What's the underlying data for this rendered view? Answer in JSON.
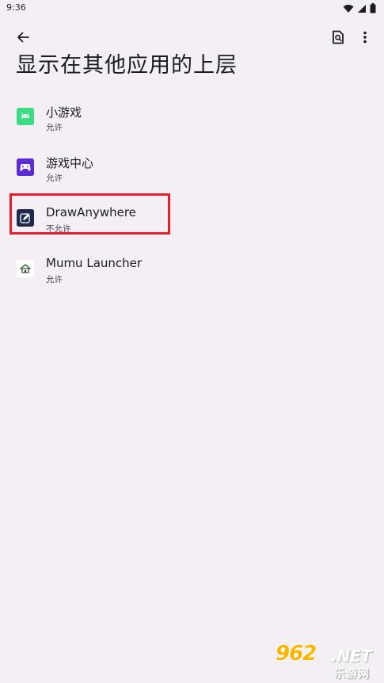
{
  "status_bar": {
    "time": "9:36"
  },
  "toolbar": {
    "back_icon": "arrow-back-icon",
    "search_icon": "search-page-icon",
    "more_icon": "more-vert-icon"
  },
  "page": {
    "title": "显示在其他应用的上层"
  },
  "apps": [
    {
      "name": "小游戏",
      "status": "允许",
      "icon": "android-icon",
      "icon_color": "#3ddc84"
    },
    {
      "name": "游戏中心",
      "status": "允许",
      "icon": "gamepad-icon",
      "icon_color": "#5b2bd6"
    },
    {
      "name": "DrawAnywhere",
      "status": "不允许",
      "icon": "draw-icon",
      "icon_color": "#1e2a4a"
    },
    {
      "name": "Mumu Launcher",
      "status": "允许",
      "icon": "home-icon",
      "icon_color": "#ffffff"
    }
  ],
  "highlight": {
    "color": "#e5202a"
  },
  "watermark": {
    "number": "962",
    "suffix": ".NET",
    "site": "乐游网"
  }
}
